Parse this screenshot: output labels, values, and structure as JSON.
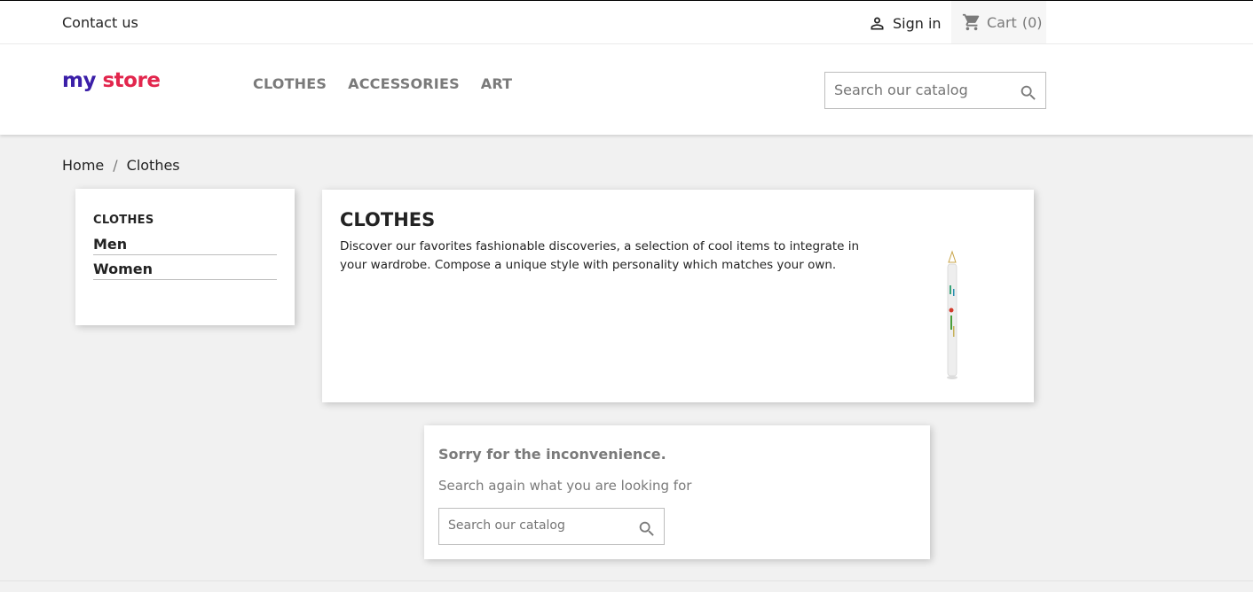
{
  "topbar": {
    "contact_label": "Contact us",
    "signin_label": "Sign in",
    "cart_label": "Cart",
    "cart_count": "(0)"
  },
  "header": {
    "logo": {
      "word1": "my",
      "word2": "store"
    },
    "nav": [
      "CLOTHES",
      "ACCESSORIES",
      "ART"
    ],
    "search_placeholder": "Search our catalog"
  },
  "breadcrumb": [
    "Home",
    "Clothes"
  ],
  "sidebar": {
    "title": "CLOTHES",
    "items": [
      "Men",
      "Women"
    ]
  },
  "category": {
    "title": "CLOTHES",
    "description": "Discover our favorites fashionable discoveries, a selection of cool items to integrate in your wardrobe. Compose a unique style with personality which matches your own."
  },
  "not_found": {
    "title": "Sorry for the inconvenience.",
    "message": "Search again what you are looking for",
    "search_placeholder": "Search our catalog"
  },
  "colors": {
    "accent_gray": "#7a7a7a",
    "text_dark": "#232323",
    "background": "#f1f1f1"
  }
}
